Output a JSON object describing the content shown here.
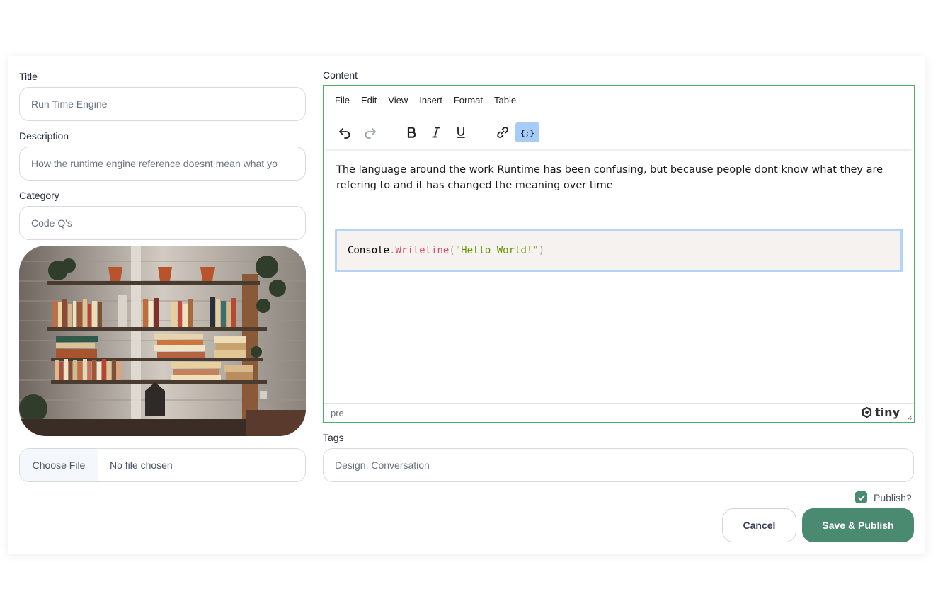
{
  "form": {
    "title": {
      "label": "Title",
      "value": "Run Time Engine"
    },
    "description": {
      "label": "Description",
      "value": "How the runtime engine reference doesnt mean what yo"
    },
    "category": {
      "label": "Category",
      "value": "Code Q's"
    },
    "file": {
      "button": "Choose File",
      "status": "No file chosen"
    },
    "content": {
      "label": "Content"
    },
    "tags": {
      "label": "Tags",
      "value": "Design, Conversation"
    },
    "publish": {
      "label": "Publish?",
      "checked": true
    }
  },
  "editor": {
    "menu": [
      "File",
      "Edit",
      "View",
      "Insert",
      "Format",
      "Table"
    ],
    "toolbar": [
      "undo-icon",
      "redo-icon",
      "bold-icon",
      "italic-icon",
      "underline-icon",
      "link-icon",
      "code-sample-icon"
    ],
    "active_tool": "code-sample-icon",
    "paragraph": "The language around the work Runtime has been confusing, but because people dont know what they are refering to and it has changed the meaning over time",
    "code": {
      "object": "Console",
      "dot": ".",
      "method": "Writeline",
      "open_paren": "(",
      "string": "\"Hello World!\"",
      "close_paren": ")"
    },
    "status_path": "pre",
    "brand": "tiny"
  },
  "actions": {
    "cancel": "Cancel",
    "save": "Save & Publish"
  },
  "colors": {
    "accent": "#4a8a70",
    "editor_border": "#4caf68",
    "code_bg": "#f5f2f0",
    "active_tool_bg": "#a6ccf7"
  }
}
